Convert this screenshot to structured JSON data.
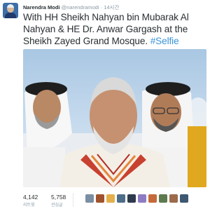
{
  "tweet": {
    "author_name": "Narendra Modi",
    "author_handle": "@narendramodi",
    "time_ago": "14시간",
    "text_main": "With HH Sheikh Nahyan bin Mubarak Al Nahyan & HE Dr. Anwar Gargash at the Sheikh Zayed Grand Mosque.",
    "hashtag": "#Selfie"
  },
  "stats": {
    "retweets_value": "4,142",
    "retweets_label": "리트윗",
    "favorites_value": "5,758",
    "favorites_label": "관심글"
  },
  "colors": {
    "link": "#3b94d9",
    "text": "#292f33",
    "muted": "#8899a6"
  },
  "favoriters": [
    {
      "name": "favoriter-avatar-1",
      "color": "#7b8fa3"
    },
    {
      "name": "favoriter-avatar-2",
      "color": "#a0522d"
    },
    {
      "name": "favoriter-avatar-3",
      "color": "#e3b04b"
    },
    {
      "name": "favoriter-avatar-4",
      "color": "#4d6e8a"
    },
    {
      "name": "favoriter-avatar-5",
      "color": "#2f3b4c"
    },
    {
      "name": "favoriter-avatar-6",
      "color": "#8e7cc3"
    },
    {
      "name": "favoriter-avatar-7",
      "color": "#c46a3a"
    },
    {
      "name": "favoriter-avatar-8",
      "color": "#5d7a4f"
    },
    {
      "name": "favoriter-avatar-9",
      "color": "#9b6b4a"
    },
    {
      "name": "favoriter-avatar-10",
      "color": "#3e5872"
    }
  ]
}
